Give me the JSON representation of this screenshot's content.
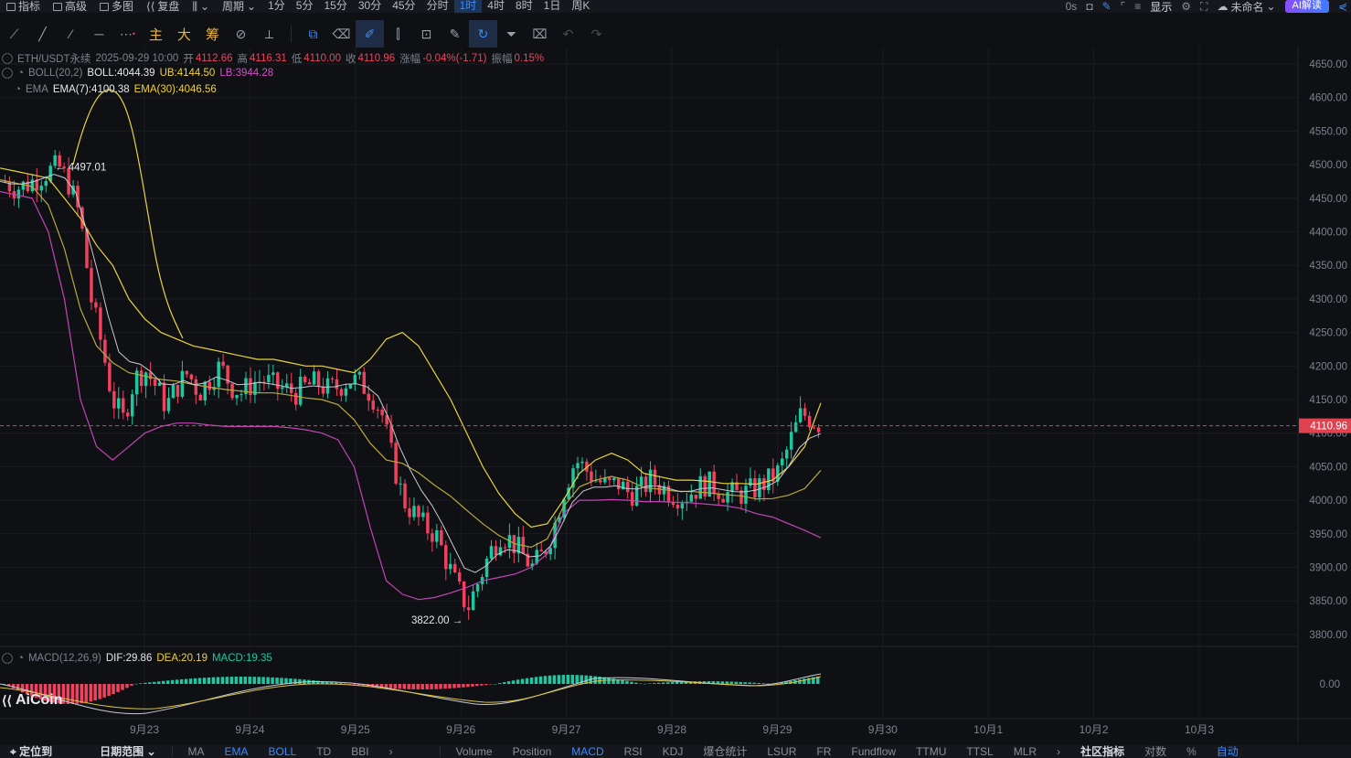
{
  "topbar": {
    "menu": [
      "指标",
      "高级",
      "多图",
      "复盘"
    ],
    "period_label": "周期",
    "periods": [
      "1分",
      "5分",
      "15分",
      "30分",
      "45分",
      "分时",
      "1时",
      "4时",
      "8时",
      "1日",
      "周K"
    ],
    "active_period": "1时",
    "right": {
      "countdown": "0s",
      "display_label": "显示",
      "layout_name": "未命名",
      "ai_button": "AI解读"
    }
  },
  "toolbar": {
    "text_tools": [
      "主",
      "大",
      "筹"
    ]
  },
  "legend": {
    "symbol": "ETH/USDT永续",
    "datetime": "2025-09-29 10:00",
    "open_label": "开",
    "open": "4112.66",
    "high_label": "高",
    "high": "4116.31",
    "low_label": "低",
    "low": "4110.00",
    "close_label": "收",
    "close": "4110.96",
    "change_label": "涨幅",
    "change": "-0.04%(-1.71)",
    "amp_label": "振幅",
    "amp": "0.15%",
    "boll_name": "BOLL(20,2)",
    "boll": "BOLL:4044.39",
    "ub": "UB:4144.50",
    "lb": "LB:3944.28",
    "ema_name": "EMA",
    "ema7": "EMA(7):4100.38",
    "ema30": "EMA(30):4046.56",
    "macd_name": "MACD(12,26,9)",
    "dif": "DIF:29.86",
    "dea": "DEA:20.19",
    "macd": "MACD:19.35"
  },
  "chart_data": {
    "type": "candlestick",
    "symbol": "ETH/USDT永续",
    "interval": "1时",
    "y_ticks": [
      4650,
      4600,
      4550,
      4500,
      4450,
      4400,
      4350,
      4300,
      4250,
      4200,
      4150,
      4100,
      4050,
      4000,
      3950,
      3900,
      3850,
      3800
    ],
    "ylim": [
      3780,
      4665
    ],
    "x_labels": [
      "9月23",
      "9月24",
      "9月25",
      "9月26",
      "9月27",
      "9月28",
      "9月29",
      "9月30",
      "10月1",
      "10月2",
      "10月3"
    ],
    "last_price": 4110.96,
    "high_marker": 4497.01,
    "low_marker": 3822.0,
    "macd_zero_label": "0.00",
    "close_path": [
      4475,
      4465,
      4470,
      4480,
      4490,
      4497,
      4470,
      4420,
      4300,
      4230,
      4150,
      4120,
      4180,
      4195,
      4170,
      4140,
      4170,
      4190,
      4160,
      4180,
      4200,
      4170,
      4160,
      4175,
      4180,
      4170,
      4165,
      4160,
      4170,
      4175,
      4165,
      4170,
      4180,
      4175,
      4160,
      4130,
      4060,
      4000,
      3980,
      3960,
      3950,
      3910,
      3870,
      3840,
      3880,
      3920,
      3950,
      3940,
      3920,
      3900,
      3920,
      3960,
      4020,
      4060,
      4045,
      4030,
      4020,
      4025,
      4010,
      4015,
      4030,
      4020,
      4010,
      4005,
      4015,
      4025,
      4020,
      4010,
      4008,
      4012,
      4020,
      4030,
      4045,
      4090,
      4130,
      4120,
      4111
    ],
    "boll_ub": [
      4495,
      4490,
      4485,
      4480,
      4450,
      4420,
      4380,
      4350,
      4300,
      4270,
      4250,
      4240,
      4230,
      4225,
      4220,
      4215,
      4210,
      4210,
      4205,
      4200,
      4200,
      4195,
      4190,
      4210,
      4240,
      4250,
      4230,
      4190,
      4150,
      4100,
      4050,
      4010,
      3980,
      3960,
      3965,
      4000,
      4040,
      4060,
      4070,
      4060,
      4040,
      4035,
      4030,
      4030,
      4028,
      4025,
      4025,
      4024,
      4030,
      4050,
      4080,
      4145
    ],
    "boll_lb": [
      4460,
      4455,
      4450,
      4400,
      4300,
      4150,
      4080,
      4060,
      4080,
      4100,
      4110,
      4115,
      4115,
      4112,
      4110,
      4110,
      4110,
      4110,
      4108,
      4105,
      4100,
      4090,
      4050,
      3960,
      3880,
      3860,
      3852,
      3855,
      3862,
      3870,
      3880,
      3885,
      3890,
      3900,
      3920,
      3980,
      4000,
      4000,
      4001,
      4000,
      3998,
      3998,
      3997,
      3996,
      3994,
      3992,
      3988,
      3980,
      3975,
      3965,
      3955,
      3944
    ]
  },
  "logo": {
    "text": "AiCoin"
  },
  "bottombar": {
    "left": [
      "定位到",
      "日期范围"
    ],
    "indicators_main": [
      "MA",
      "EMA",
      "BOLL",
      "TD",
      "BBI"
    ],
    "indicators_sub": [
      "Volume",
      "Position",
      "MACD",
      "RSI",
      "KDJ",
      "爆仓统计",
      "LSUR",
      "FR",
      "Fundflow",
      "TTMU",
      "TTSL",
      "MLR"
    ],
    "right": [
      "社区指标",
      "对数",
      "%",
      "自动"
    ]
  }
}
